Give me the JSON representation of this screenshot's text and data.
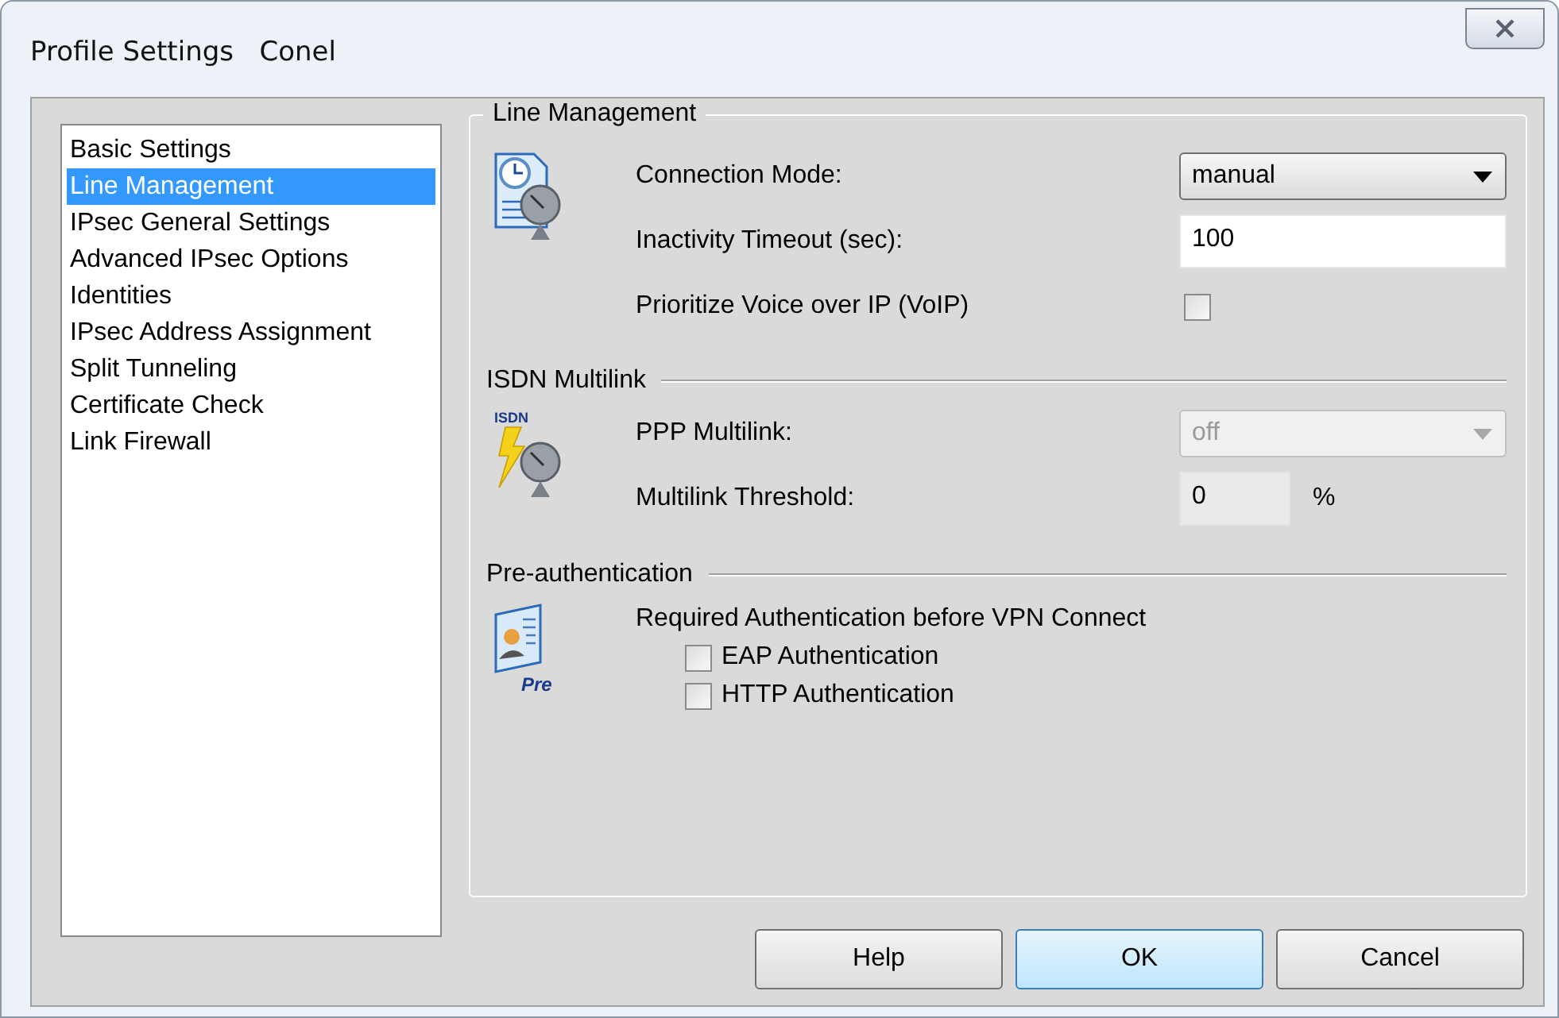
{
  "window": {
    "title": "Profile Settings   Conel"
  },
  "sidebar": {
    "items": [
      {
        "label": "Basic Settings",
        "selected": false
      },
      {
        "label": "Line Management",
        "selected": true
      },
      {
        "label": "IPsec General Settings",
        "selected": false
      },
      {
        "label": "Advanced IPsec Options",
        "selected": false
      },
      {
        "label": "Identities",
        "selected": false
      },
      {
        "label": "IPsec Address Assignment",
        "selected": false
      },
      {
        "label": "Split Tunneling",
        "selected": false
      },
      {
        "label": "Certificate Check",
        "selected": false
      },
      {
        "label": "Link Firewall",
        "selected": false
      }
    ]
  },
  "panel": {
    "title": "Line Management",
    "sections": [
      {
        "rows": [
          {
            "kind": "dropdown",
            "label": "Connection Mode:",
            "value": "manual",
            "disabled": false
          },
          {
            "kind": "text",
            "label": "Inactivity Timeout (sec):",
            "value": "100",
            "disabled": false
          },
          {
            "kind": "checkbox",
            "label": "Prioritize Voice over IP (VoIP)",
            "checked": false
          }
        ]
      },
      {
        "title": "ISDN Multilink",
        "icon_text": "ISDN",
        "rows": [
          {
            "kind": "dropdown",
            "label": "PPP Multilink:",
            "value": "off",
            "disabled": true
          },
          {
            "kind": "number",
            "label": "Multilink Threshold:",
            "value": "0",
            "unit": "%",
            "disabled": true
          }
        ]
      },
      {
        "title": "Pre-authentication",
        "icon_text": "Pre",
        "description": "Required Authentication before VPN Connect",
        "options": [
          {
            "label": "EAP Authentication",
            "checked": false
          },
          {
            "label": "HTTP Authentication",
            "checked": false
          }
        ]
      }
    ]
  },
  "buttons": [
    {
      "label": "Help",
      "default": false
    },
    {
      "label": "OK",
      "default": true
    },
    {
      "label": "Cancel",
      "default": false
    }
  ]
}
